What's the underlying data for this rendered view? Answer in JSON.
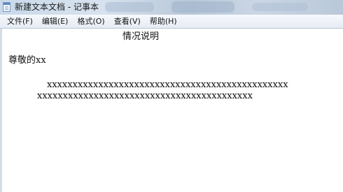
{
  "window": {
    "title": "新建文本文档 - 记事本",
    "icon": "notepad-icon"
  },
  "menu": {
    "items": [
      {
        "label": "文件(F)"
      },
      {
        "label": "编辑(E)"
      },
      {
        "label": "格式(O)"
      },
      {
        "label": "查看(V)"
      },
      {
        "label": "帮助(H)"
      }
    ]
  },
  "document": {
    "title": "情况说明",
    "greeting": "尊敬的xx",
    "lines": [
      "xxxxxxxxxxxxxxxxxxxxxxxxxxxxxxxxxxxxxxxxxxxxxxx",
      "xxxxxxxxxxxxxxxxxxxxxxxxxxxxxxxxxxxxxxxxxx"
    ]
  }
}
